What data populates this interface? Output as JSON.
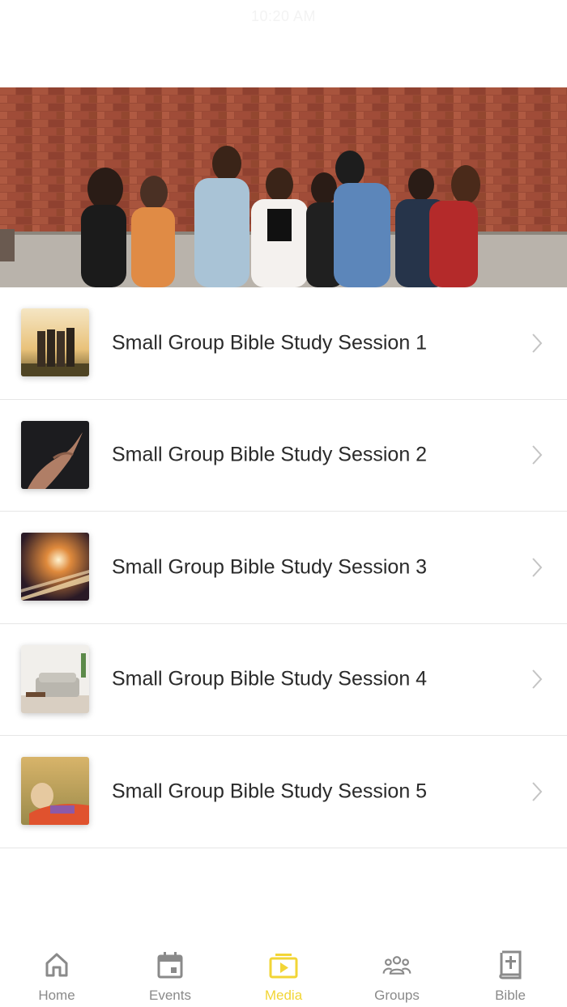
{
  "status_bar": {
    "time": "10:20 AM"
  },
  "hero": {
    "image": "group-of-friends-brick-wall-photo"
  },
  "sessions": [
    {
      "title": "Small Group Bible Study Session 1",
      "thumbnail": "friends-sunset-photo"
    },
    {
      "title": "Small Group Bible Study Session 2",
      "thumbnail": "open-hand-photo"
    },
    {
      "title": "Small Group Bible Study Session 3",
      "thumbnail": "light-trails-photo"
    },
    {
      "title": "Small Group Bible Study Session 4",
      "thumbnail": "living-room-photo"
    },
    {
      "title": "Small Group Bible Study Session 5",
      "thumbnail": "hammock-photo"
    }
  ],
  "tabs": [
    {
      "label": "Home",
      "icon": "home-icon",
      "active": false
    },
    {
      "label": "Events",
      "icon": "calendar-icon",
      "active": false
    },
    {
      "label": "Media",
      "icon": "media-play-icon",
      "active": true
    },
    {
      "label": "Groups",
      "icon": "groups-icon",
      "active": false
    },
    {
      "label": "Bible",
      "icon": "bible-icon",
      "active": false
    }
  ],
  "colors": {
    "accent": "#f2d536",
    "inactive": "#8a8a8a",
    "divider": "#e6e6e6"
  }
}
